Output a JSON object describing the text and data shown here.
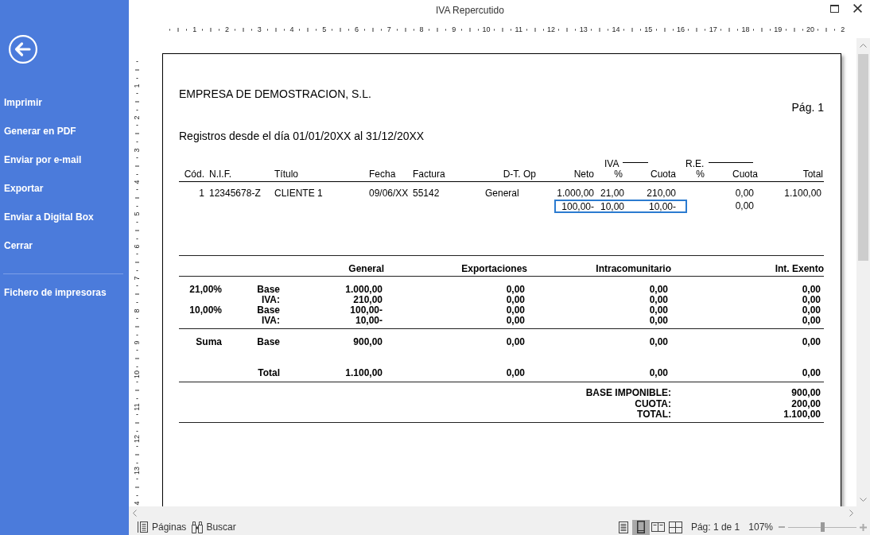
{
  "window": {
    "title": "IVA Repercutido"
  },
  "sidebar": {
    "item_groups": [
      {
        "items": [
          "Imprimir",
          "Generar en PDF",
          "Enviar por e-mail",
          "Exportar",
          "Enviar a Digital Box",
          "Cerrar"
        ]
      },
      {
        "items": [
          "Fichero de impresoras"
        ]
      }
    ]
  },
  "rulers": {
    "horizontal": [
      "1",
      "2",
      "3",
      "4",
      "5",
      "6",
      "7",
      "8",
      "9",
      "10",
      "11",
      "12",
      "13",
      "14",
      "15",
      "16",
      "17",
      "18",
      "19",
      "20",
      "2"
    ],
    "vertical": [
      "1",
      "2",
      "3",
      "4",
      "5",
      "6",
      "7",
      "8",
      "9",
      "10",
      "11",
      "12",
      "13",
      "4"
    ]
  },
  "report": {
    "company": "EMPRESA DE DEMOSTRACION, S.L.",
    "page_label": "Pág. 1",
    "range": "Registros desde el día 01/01/20XX al 31/12/20XX",
    "column_groups": [
      "IVA",
      "R.E."
    ],
    "columns": [
      "Cód.",
      "N.I.F.",
      "Título",
      "Fecha",
      "Factura",
      "D-T. Op",
      "Neto",
      "%",
      "Cuota",
      "%",
      "Cuota",
      "Total"
    ],
    "records": [
      {
        "cod": "1",
        "nif": "12345678-Z",
        "titulo": "CLIENTE 1",
        "fecha": "09/06/XX",
        "factura": "55142",
        "dt_op": "General",
        "lines": [
          {
            "neto": "1.000,00",
            "iva_pct": "21,00",
            "iva_cuota": "210,00",
            "re_cuota": "0,00",
            "total": "1.100,00",
            "selected": false
          },
          {
            "neto": "100,00-",
            "iva_pct": "10,00",
            "iva_cuota": "10,00-",
            "re_cuota": "0,00",
            "selected": true
          }
        ]
      }
    ],
    "summary": {
      "columns": [
        "General",
        "Exportaciones",
        "Intracomunitario",
        "Int. Exento"
      ],
      "rate_rows": [
        {
          "rate": "21,00%",
          "label": "Base",
          "values": [
            "1.000,00",
            "0,00",
            "0,00",
            "0,00"
          ]
        },
        {
          "label": "IVA:",
          "values": [
            "210,00",
            "0,00",
            "0,00",
            "0,00"
          ]
        },
        {
          "rate": "10,00%",
          "label": "Base",
          "values": [
            "100,00-",
            "0,00",
            "0,00",
            "0,00"
          ]
        },
        {
          "label": "IVA:",
          "values": [
            "10,00-",
            "0,00",
            "0,00",
            "0,00"
          ]
        }
      ],
      "sum_rows": [
        {
          "rate": "Suma",
          "label": "Base",
          "values": [
            "900,00",
            "0,00",
            "0,00",
            "0,00"
          ]
        },
        {
          "label": "Total",
          "values": [
            "1.100,00",
            "0,00",
            "0,00",
            "0,00"
          ]
        }
      ],
      "totals": [
        {
          "label": "BASE IMPONIBLE:",
          "value": "900,00"
        },
        {
          "label": "CUOTA:",
          "value": "200,00"
        },
        {
          "label": "TOTAL:",
          "value": "1.100,00"
        }
      ]
    }
  },
  "status_bar": {
    "pages_button": "Páginas",
    "search_button": "Buscar",
    "view_modes": [
      {
        "kind": "page-lines",
        "selected": false
      },
      {
        "kind": "page",
        "selected": true
      },
      {
        "kind": "two-pages",
        "selected": false
      },
      {
        "kind": "four-pages",
        "selected": false
      }
    ],
    "page_info": "Pág: 1 de 1",
    "zoom": "107%",
    "zoom_slider": {
      "level": 0.5
    }
  }
}
